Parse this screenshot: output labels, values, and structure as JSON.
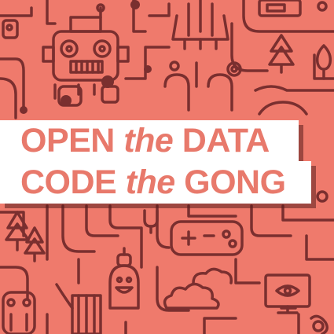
{
  "headline": {
    "line1": {
      "pre": "OPEN",
      "mid": "the",
      "post": "DATA"
    },
    "line2": {
      "pre": "CODE",
      "mid": "the",
      "post": "GONG"
    }
  },
  "colors": {
    "background": "#ef7a6c",
    "line_art": "#7a2f2f",
    "banner": "#ffffff",
    "headline_text": "#e8796b"
  },
  "illustration": [
    "robot-icon",
    "rocket-icon",
    "tree-icon",
    "game-controller-icon",
    "cloud-icon",
    "monitor-eye-icon",
    "smiling-character-icon",
    "robot-legs-icon",
    "dot-nodes"
  ]
}
